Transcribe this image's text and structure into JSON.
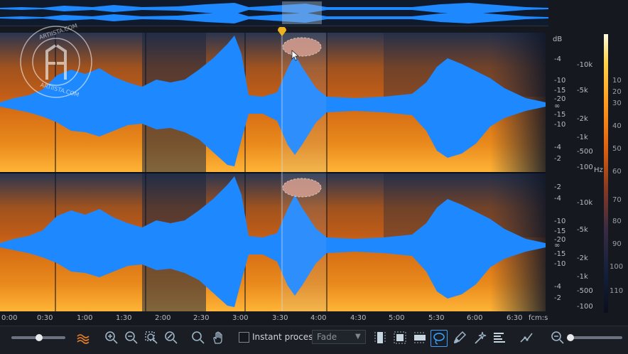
{
  "watermark": {
    "text_top": "ARTIISTA.COM",
    "text_bottom": "ARTIISTA.COM",
    "monogram": "AA"
  },
  "db_scale_top": [
    "dB",
    "-4",
    "-10",
    "-15",
    "-20",
    "∞",
    "-15",
    "-10",
    "-4",
    "-2"
  ],
  "db_scale_bottom": [
    "-2",
    "-4",
    "-10",
    "-15",
    "-20",
    "∞",
    "-15",
    "-10",
    "-4",
    "-2"
  ],
  "freq_scale_top": [
    "-10k",
    "-5k",
    "-2k",
    "-1k",
    "-500",
    "-100"
  ],
  "freq_unit": "Hz",
  "freq_scale_bottom": [
    "-10k",
    "-5k",
    "-2k",
    "-1k",
    "-500",
    "-100"
  ],
  "colorbar_scale": [
    "10",
    "20",
    "30",
    "40",
    "50",
    "60",
    "70",
    "80",
    "90",
    "100",
    "110"
  ],
  "time_ruler": [
    "0:00",
    "0:30",
    "1:00",
    "1:30",
    "2:00",
    "2:30",
    "3:00",
    "3:30",
    "4:00",
    "4:30",
    "5:00",
    "5:30",
    "6:00",
    "6:30"
  ],
  "time_unit": "fcm:s",
  "toolbar": {
    "instant_process_label": "Instant process",
    "fade_value": "Fade"
  },
  "colors": {
    "waveform": "#1e88ff",
    "spectrogram_hot": "#ff9a1e",
    "background": "#15191f",
    "playhead": "#f0b21e"
  },
  "icons": [
    "waveform-toggle-icon",
    "zoom-in-icon",
    "zoom-out-icon",
    "zoom-selection-icon",
    "zoom-fit-icon",
    "magnify-icon",
    "hand-icon",
    "time-selection-icon",
    "frequency-selection-icon",
    "time-frequency-selection-icon",
    "lasso-icon",
    "brush-icon",
    "magic-wand-icon",
    "harmonic-selection-icon",
    "pencil-icon",
    "zoom-icon"
  ]
}
